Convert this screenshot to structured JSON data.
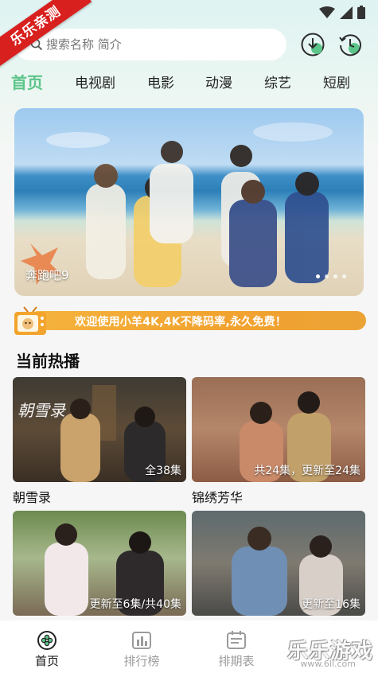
{
  "watermark_ribbon": "乐乐亲测",
  "search": {
    "placeholder": "搜索名称 简介"
  },
  "header_icons": [
    "download-icon",
    "history-icon"
  ],
  "tabs": [
    {
      "label": "首页",
      "active": true
    },
    {
      "label": "电视剧",
      "active": false
    },
    {
      "label": "电影",
      "active": false
    },
    {
      "label": "动漫",
      "active": false
    },
    {
      "label": "综艺",
      "active": false
    },
    {
      "label": "短剧",
      "active": false
    }
  ],
  "banner": {
    "title": "奔跑吧9",
    "dots": 4,
    "active_dot": 0
  },
  "notice": {
    "text": "欢迎使用小羊4K,4K不降码率,永久免费！"
  },
  "section": {
    "title": "当前热播"
  },
  "cards": [
    {
      "name": "朝雪录",
      "badge": "全38集",
      "poster_text": "朝雪录"
    },
    {
      "name": "锦绣芳华",
      "badge": "共24集，更新至24集"
    },
    {
      "name": "",
      "badge": "更新至6集/共40集"
    },
    {
      "name": "",
      "badge": "更新至16集"
    }
  ],
  "bottom_nav": [
    {
      "label": "首页",
      "icon": "home-icon",
      "active": true
    },
    {
      "label": "排行榜",
      "icon": "chart-icon",
      "active": false
    },
    {
      "label": "排期表",
      "icon": "calendar-icon",
      "active": false
    }
  ],
  "site_watermark": {
    "text": "乐乐游戏",
    "sub": "www.6ll.com"
  },
  "colors": {
    "accent": "#5cc58a",
    "notice": "#f2a22f",
    "ribbon": "#d8201e"
  }
}
